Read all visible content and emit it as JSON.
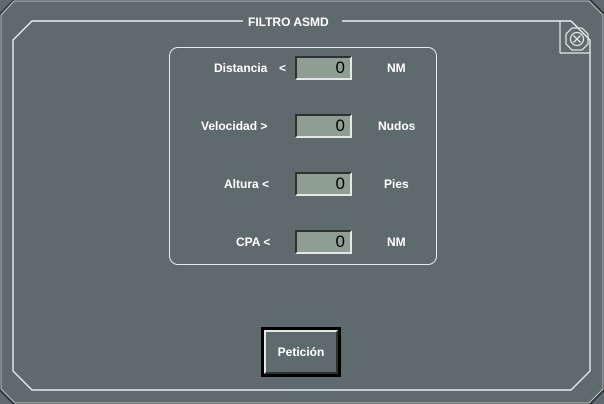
{
  "window": {
    "title": "FILTRO ASMD",
    "close_icon": "close-circle-x-icon"
  },
  "filters": [
    {
      "label": "Distancia",
      "operator": "<",
      "value": "0",
      "unit": "NM"
    },
    {
      "label": "Velocidad >",
      "operator": "",
      "value": "0",
      "unit": "Nudos"
    },
    {
      "label": "Altura <",
      "operator": "",
      "value": "0",
      "unit": "Pies"
    },
    {
      "label": "CPA <",
      "operator": "",
      "value": "0",
      "unit": "NM"
    }
  ],
  "actions": {
    "request_label": "Petición"
  },
  "colors": {
    "panel": "#5f6a6c",
    "field": "#8e9e93",
    "text": "#ffffff"
  }
}
